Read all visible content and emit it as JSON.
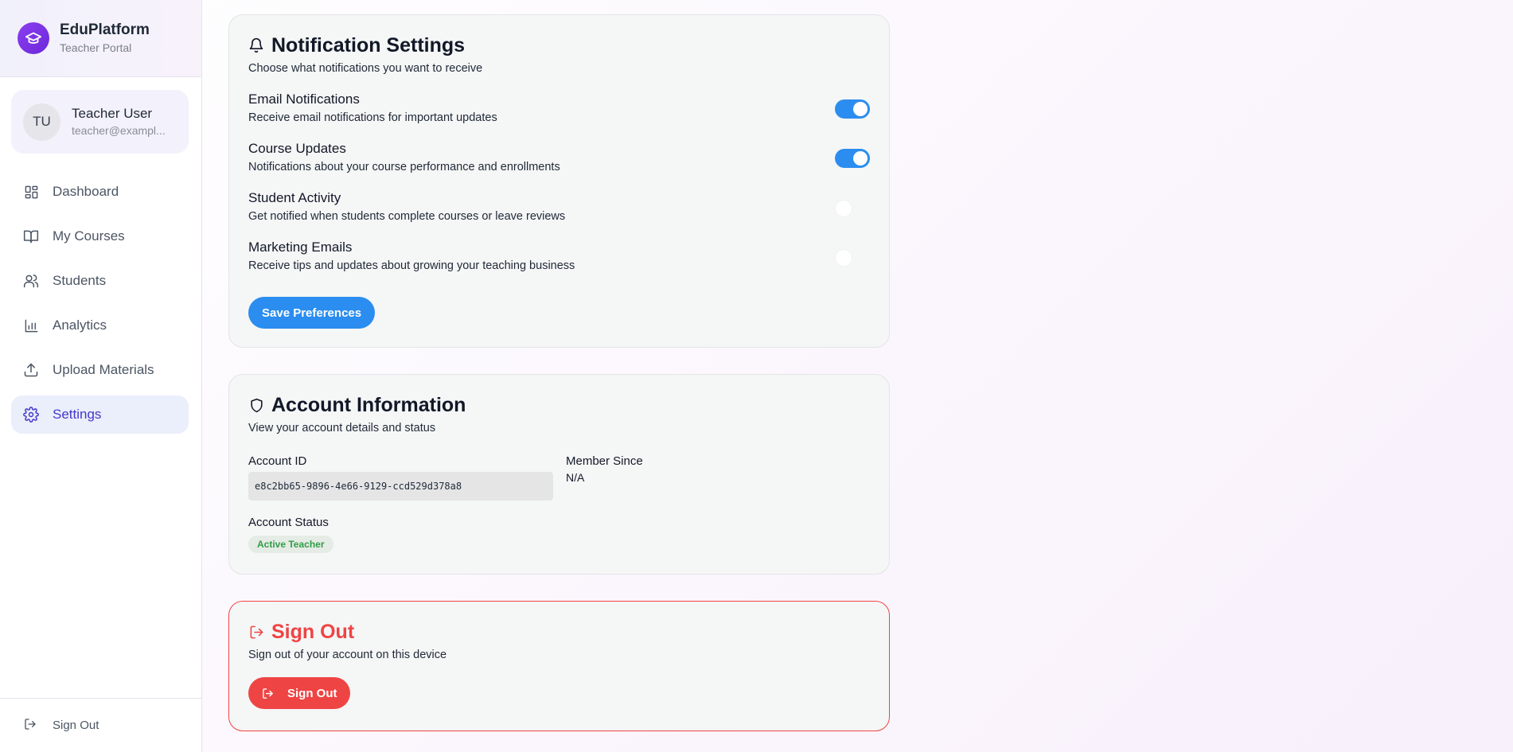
{
  "brand": {
    "name": "EduPlatform",
    "subtitle": "Teacher Portal",
    "logo_icon": "graduation-cap-icon"
  },
  "user": {
    "initials": "TU",
    "name": "Teacher User",
    "email": "teacher@exampl..."
  },
  "nav": {
    "items": [
      {
        "label": "Dashboard",
        "icon": "dashboard-icon",
        "active": false
      },
      {
        "label": "My Courses",
        "icon": "book-icon",
        "active": false
      },
      {
        "label": "Students",
        "icon": "users-icon",
        "active": false
      },
      {
        "label": "Analytics",
        "icon": "bar-chart-icon",
        "active": false
      },
      {
        "label": "Upload Materials",
        "icon": "upload-icon",
        "active": false
      },
      {
        "label": "Settings",
        "icon": "gear-icon",
        "active": true
      }
    ],
    "footer_signout": "Sign Out"
  },
  "notifications": {
    "title": "Notification Settings",
    "description": "Choose what notifications you want to receive",
    "preferences": [
      {
        "title": "Email Notifications",
        "description": "Receive email notifications for important updates",
        "enabled": true
      },
      {
        "title": "Course Updates",
        "description": "Notifications about your course performance and enrollments",
        "enabled": true
      },
      {
        "title": "Student Activity",
        "description": "Get notified when students complete courses or leave reviews",
        "enabled": false
      },
      {
        "title": "Marketing Emails",
        "description": "Receive tips and updates about growing your teaching business",
        "enabled": false
      }
    ],
    "save_label": "Save Preferences"
  },
  "account": {
    "title": "Account Information",
    "description": "View your account details and status",
    "id_label": "Account ID",
    "id_value": "e8c2bb65-9896-4e66-9129-ccd529d378a8",
    "member_since_label": "Member Since",
    "member_since_value": "N/A",
    "status_label": "Account Status",
    "status_value": "Active Teacher"
  },
  "signout": {
    "title": "Sign Out",
    "description": "Sign out of your account on this device",
    "button_label": "Sign Out"
  },
  "colors": {
    "accent": "#2b8def",
    "brand": "#7c3aed",
    "active_nav": "#4338ca",
    "danger": "#ef4444",
    "status_green": "#2f9e45"
  }
}
